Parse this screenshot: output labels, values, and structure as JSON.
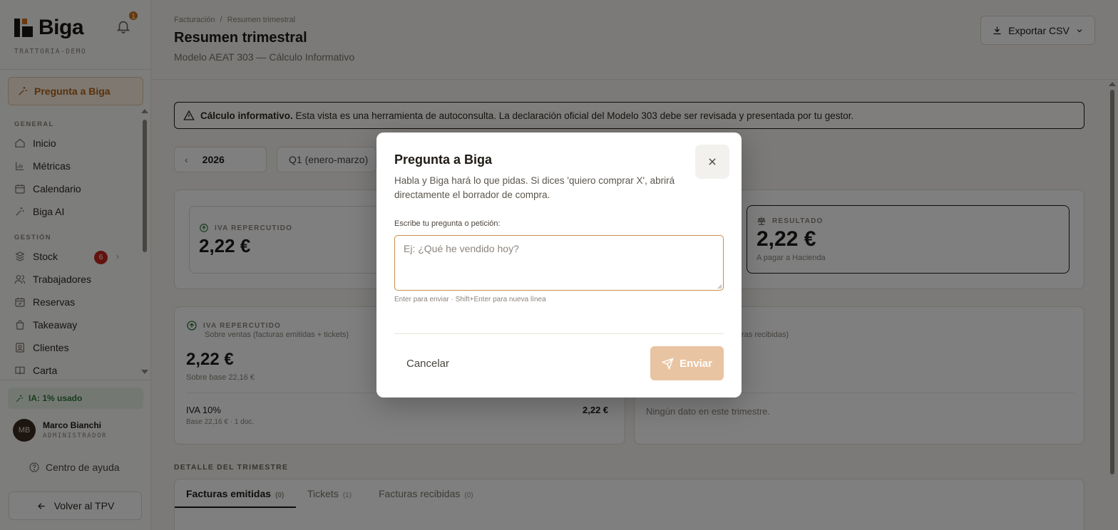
{
  "sidebar": {
    "brand": "Biga",
    "notifications_count": "1",
    "tenant": "TRATTORIA-DEMO",
    "ask_label": "Pregunta a Biga",
    "section_general": "GENERAL",
    "section_gestion": "GESTIÓN",
    "items": [
      {
        "label": "Inicio",
        "icon": "home-icon"
      },
      {
        "label": "Métricas",
        "icon": "chart-icon"
      },
      {
        "label": "Calendario",
        "icon": "calendar-icon"
      },
      {
        "label": "Biga AI",
        "icon": "sparkle-icon"
      },
      {
        "label": "Stock",
        "icon": "boxes-icon",
        "badge": "6"
      },
      {
        "label": "Trabajadores",
        "icon": "users-icon"
      },
      {
        "label": "Reservas",
        "icon": "calendar-check-icon"
      },
      {
        "label": "Takeaway",
        "icon": "bag-icon"
      },
      {
        "label": "Clientes",
        "icon": "contact-icon"
      },
      {
        "label": "Carta",
        "icon": "book-icon"
      }
    ],
    "ai_usage": "IA: 1% usado",
    "user": {
      "initials": "MB",
      "name": "Marco Bianchi",
      "role": "ADMINISTRADOR"
    },
    "help_label": "Centro de ayuda",
    "back_label": "Volver al TPV"
  },
  "header": {
    "breadcrumb_root": "Facturación",
    "breadcrumb_sep": "/",
    "breadcrumb_current": "Resumen trimestral",
    "title": "Resumen trimestral",
    "subtitle": "Modelo AEAT 303 — Cálculo Informativo",
    "export_label": "Exportar CSV"
  },
  "warning": {
    "bold": "Cálculo informativo.",
    "text": "Esta vista es una herramienta de autoconsulta. La declaración oficial del Modelo 303 debe ser revisada y presentada por tu gestor."
  },
  "period": {
    "year": "2026",
    "quarter": "Q1 (enero-marzo)"
  },
  "summary": {
    "iva_repercutido_label": "IVA REPERCUTIDO",
    "iva_repercutido_value": "2,22 €",
    "resultado_label": "RESULTADO",
    "resultado_value": "2,22 €",
    "resultado_note": "A pagar a Hacienda"
  },
  "detail_left": {
    "label": "IVA REPERCUTIDO",
    "sub": "Sobre ventas (facturas emitidas + tickets)",
    "value": "2,22 €",
    "base": "Sobre base 22,16 €",
    "row_label": "IVA 10%",
    "row_value": "2,22 €",
    "row_sub": "Base 22,16 € · 1 doc."
  },
  "detail_right": {
    "sub": "ras recibidas)",
    "empty": "Ningún dato en este trimestre."
  },
  "quarter_detail": {
    "label": "DETALLE DEL TRIMESTRE",
    "tabs": [
      {
        "label": "Facturas emitidas",
        "count": "(0)"
      },
      {
        "label": "Tickets",
        "count": "(1)"
      },
      {
        "label": "Facturas recibidas",
        "count": "(0)"
      }
    ]
  },
  "modal": {
    "title": "Pregunta a Biga",
    "description": "Habla y Biga hará lo que pidas. Si dices 'quiero comprar X', abrirá directamente el borrador de compra.",
    "field_label": "Escribe tu pregunta o petición:",
    "placeholder": "Ej: ¿Qué he vendido hoy?",
    "hint": "Enter para enviar · Shift+Enter para nueva línea",
    "cancel_label": "Cancelar",
    "send_label": "Enviar"
  },
  "colors": {
    "accent": "#c8731c",
    "send_disabled": "#e9c4a2",
    "warning_border": "#1f1b16"
  }
}
